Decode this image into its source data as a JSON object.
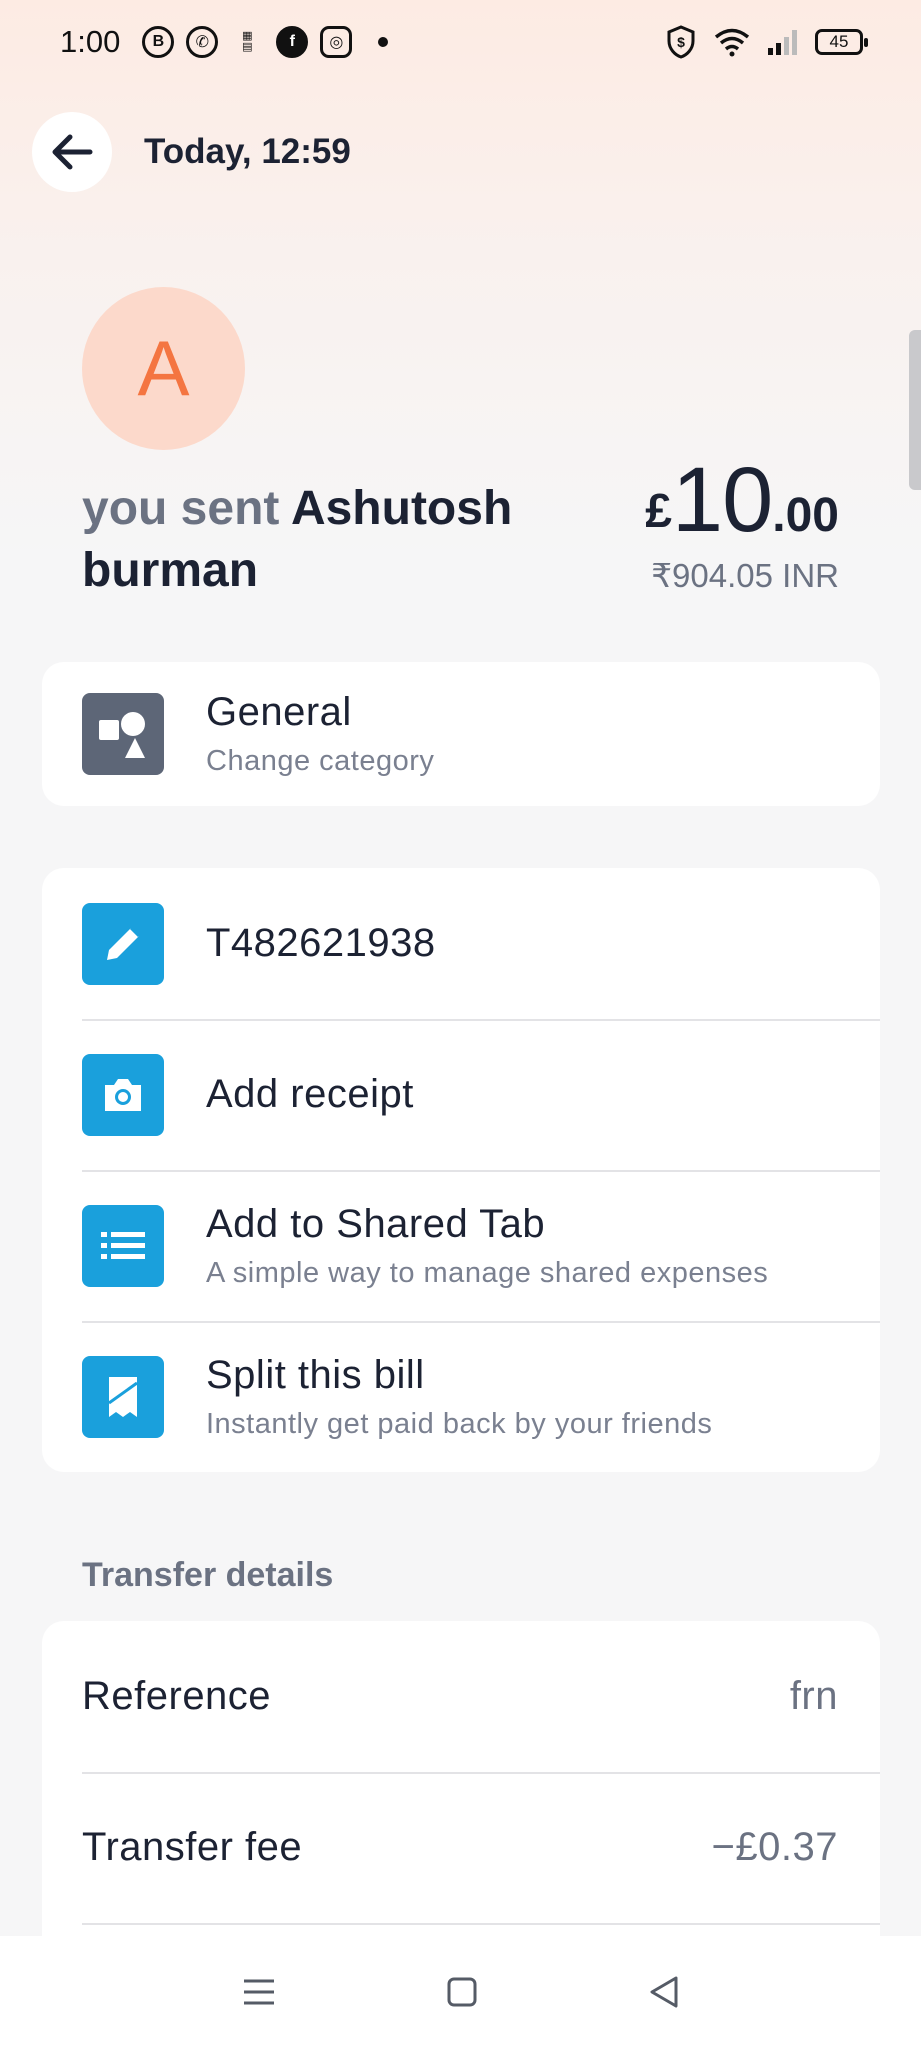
{
  "status_bar": {
    "time": "1:00",
    "battery": "45",
    "app_icons": [
      "b-icon",
      "whatsapp-icon",
      "news-icon",
      "facebook-icon",
      "instagram-icon"
    ]
  },
  "header": {
    "title": "Today, 12:59"
  },
  "transaction": {
    "avatar_letter": "A",
    "sent_prefix": "you sent",
    "recipient": "Ashutosh burman",
    "amount_currency": "£",
    "amount_major": "10",
    "amount_minor": ".00",
    "converted_amount": "₹904.05 INR"
  },
  "category": {
    "title": "General",
    "subtitle": "Change category"
  },
  "actions": [
    {
      "title": "T482621938",
      "subtitle": "",
      "icon": "pencil-icon"
    },
    {
      "title": "Add receipt",
      "subtitle": "",
      "icon": "camera-icon"
    },
    {
      "title": "Add to Shared Tab",
      "subtitle": "A simple way to manage shared expenses",
      "icon": "list-icon"
    },
    {
      "title": "Split this bill",
      "subtitle": "Instantly get paid back by your friends",
      "icon": "receipt-icon"
    }
  ],
  "transfer_details": {
    "section_title": "Transfer details",
    "rows": [
      {
        "label": "Reference",
        "value": "frn"
      },
      {
        "label": "Transfer fee",
        "value": "−£0.37"
      }
    ]
  },
  "colors": {
    "accent_blue": "#1aa0dc",
    "avatar_bg": "#fcd9cb",
    "avatar_letter": "#f47541",
    "category_tile": "#5d6677"
  }
}
